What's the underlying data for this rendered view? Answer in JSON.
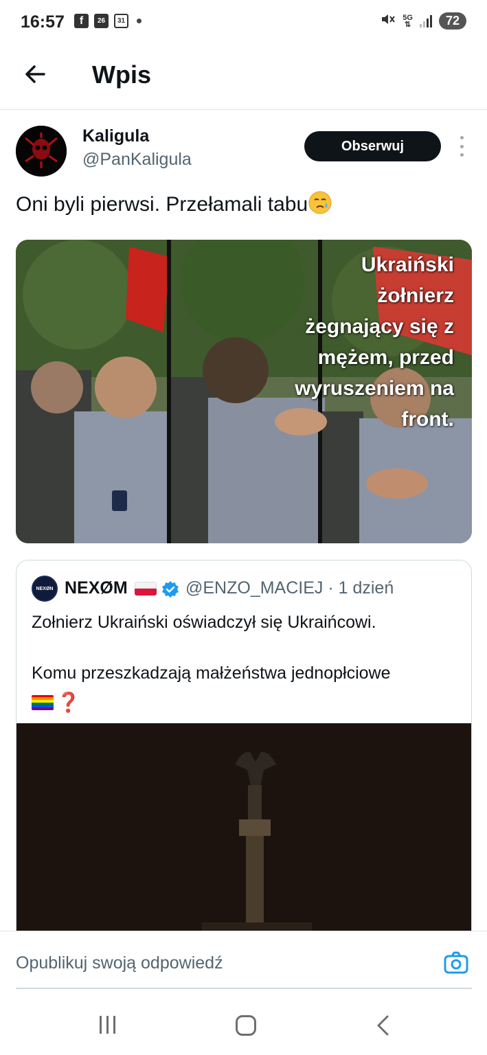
{
  "status_bar": {
    "time": "16:57",
    "notif_icons": [
      "facebook-icon",
      "calendar-26-icon",
      "calendar-31-icon"
    ],
    "calendar_day_1": "26",
    "calendar_day_2": "31",
    "network": "5G",
    "battery": "72"
  },
  "header": {
    "title": "Wpis"
  },
  "tweet": {
    "author_name": "Kaligula",
    "author_handle": "@PanKaligula",
    "follow_label": "Obserwuj",
    "text": "Oni byli pierwsi. Przełamali tabu",
    "media_caption_lines": [
      "Ukraiński",
      "żołnierz",
      "żegnający się z",
      "mężem, przed",
      "wyruszeniem na",
      "front."
    ]
  },
  "quoted_tweet": {
    "author_name": "NEXØM",
    "avatar_text": "NEXØN",
    "author_handle": "@ENZO_MACIEJ · 1 dzień",
    "text_line1": "Zołnierz Ukraiński oświadczył się Ukraińcowi.",
    "text_line2": "Komu przeszkadzają małżeństwa jednopłciowe",
    "emoji_tail": "❓"
  },
  "reply_bar": {
    "placeholder": "Opublikuj swoją odpowiedź"
  },
  "colors": {
    "accent": "#1d9bf0",
    "text_primary": "#0f1419",
    "text_secondary": "#536471"
  }
}
